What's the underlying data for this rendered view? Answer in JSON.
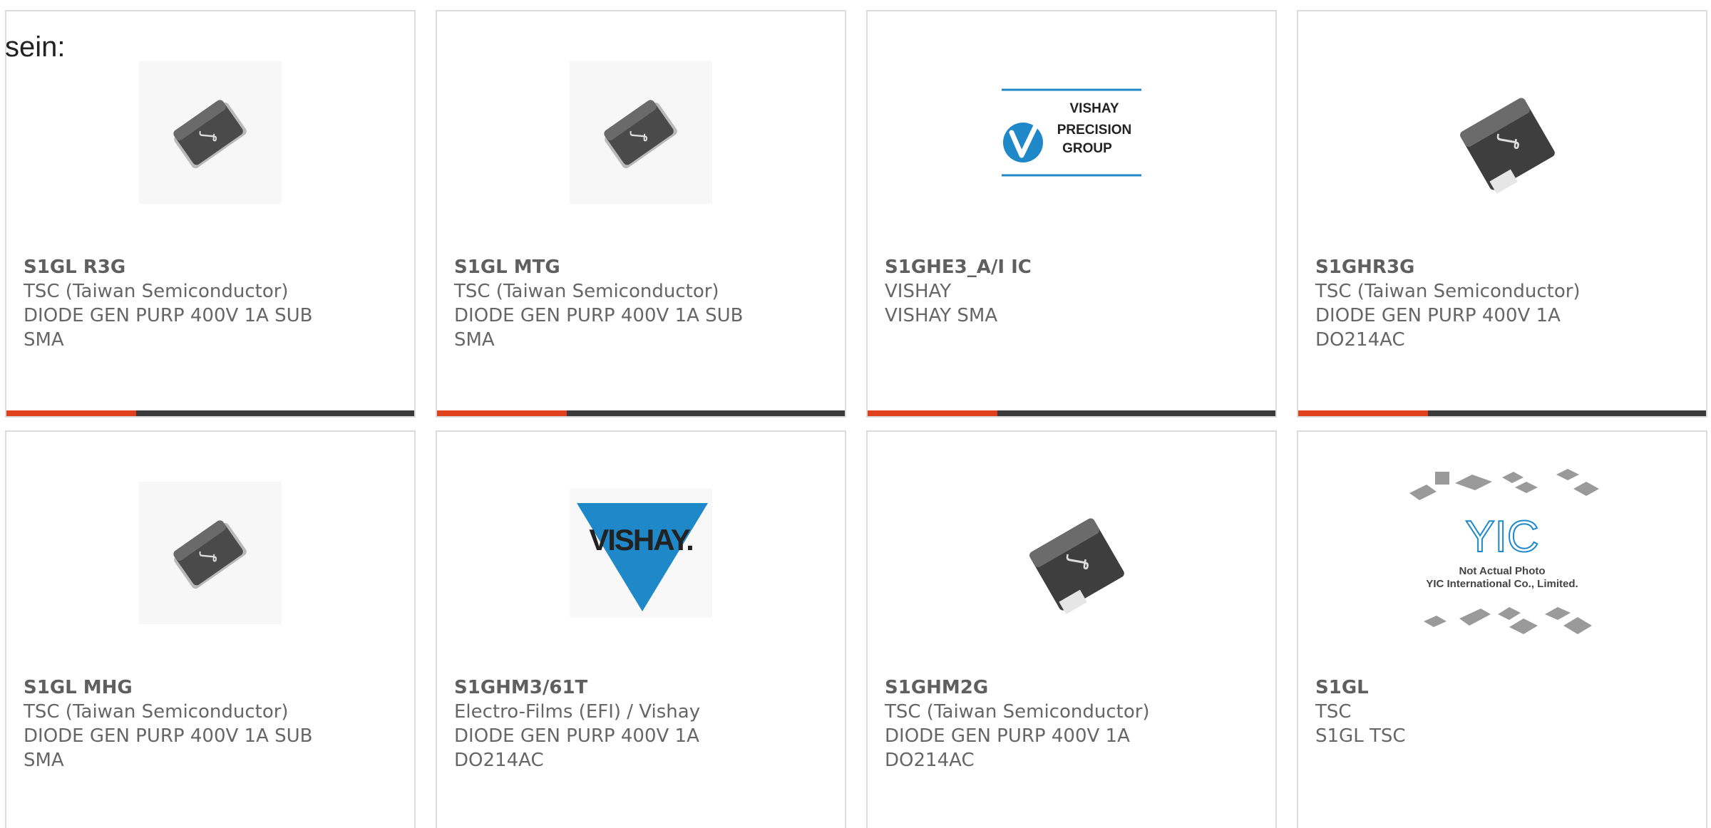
{
  "intro_text": "sein:",
  "colors": {
    "accent": "#e0401c",
    "bar_dark": "#3a3a3a",
    "text": "#666666",
    "border": "#dcdcdc",
    "vishay_blue": "#1f88c9"
  },
  "products": [
    {
      "part_number": "S1GL R3G",
      "manufacturer": "TSC (Taiwan Semiconductor)",
      "description_line1": "DIODE GEN PURP 400V 1A SUB",
      "description_line2": "SMA",
      "image": "sma-diode-package-icon"
    },
    {
      "part_number": "S1GL MTG",
      "manufacturer": "TSC (Taiwan Semiconductor)",
      "description_line1": "DIODE GEN PURP 400V 1A SUB",
      "description_line2": "SMA",
      "image": "sma-diode-package-icon"
    },
    {
      "part_number": "S1GHE3_A/I IC",
      "manufacturer": "VISHAY",
      "description_line1": "VISHAY SMA",
      "description_line2": "",
      "image": "vishay-precision-group-logo",
      "logo_text": [
        "VISHAY",
        "PRECISION",
        "GROUP"
      ]
    },
    {
      "part_number": "S1GHR3G",
      "manufacturer": "TSC (Taiwan Semiconductor)",
      "description_line1": "DIODE GEN PURP 400V 1A",
      "description_line2": "DO214AC",
      "image": "do214ac-diode-package-icon"
    },
    {
      "part_number": "S1GL MHG",
      "manufacturer": "TSC (Taiwan Semiconductor)",
      "description_line1": "DIODE GEN PURP 400V 1A SUB",
      "description_line2": "SMA",
      "image": "sma-diode-package-icon"
    },
    {
      "part_number": "S1GHM3/61T",
      "manufacturer": "Electro-Films (EFI) / Vishay",
      "description_line1": "DIODE GEN PURP 400V 1A",
      "description_line2": "DO214AC",
      "image": "vishay-logo",
      "logo_text": "VISHAY."
    },
    {
      "part_number": "S1GHM2G",
      "manufacturer": "TSC (Taiwan Semiconductor)",
      "description_line1": "DIODE GEN PURP 400V 1A",
      "description_line2": "DO214AC",
      "image": "do214ac-diode-package-icon"
    },
    {
      "part_number": "S1GL",
      "manufacturer": "TSC",
      "description_line1": "S1GL TSC",
      "description_line2": "",
      "image": "yic-not-actual-photo-placeholder",
      "logo_text": [
        "YIC",
        "Not Actual Photo",
        "YIC International Co., Limited."
      ]
    }
  ]
}
